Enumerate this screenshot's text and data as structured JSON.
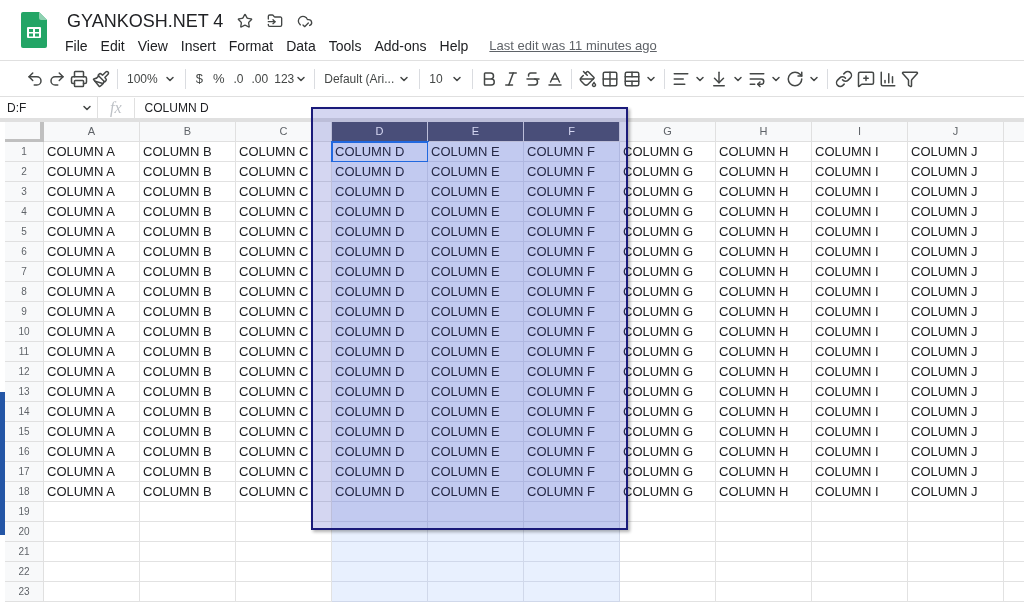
{
  "document": {
    "title": "GYANKOSH.NET 4",
    "menus": [
      "File",
      "Edit",
      "View",
      "Insert",
      "Format",
      "Data",
      "Tools",
      "Add-ons",
      "Help"
    ],
    "last_edit": "Last edit was 11 minutes ago"
  },
  "toolbar": {
    "zoom": "100%",
    "currency": "$",
    "percent": "%",
    "decrease_decimals": ".0",
    "increase_decimals": ".00",
    "number_format": "123",
    "font": "Default (Ari...",
    "font_size": "10"
  },
  "formula_bar": {
    "name_box": "D:F",
    "fx": "fx",
    "content": "COLUMN D"
  },
  "grid": {
    "columns": [
      {
        "label": "A",
        "selected": false
      },
      {
        "label": "B",
        "selected": false
      },
      {
        "label": "C",
        "selected": false
      },
      {
        "label": "D",
        "selected": true
      },
      {
        "label": "E",
        "selected": true
      },
      {
        "label": "F",
        "selected": true
      },
      {
        "label": "G",
        "selected": false
      },
      {
        "label": "H",
        "selected": false
      },
      {
        "label": "I",
        "selected": false
      },
      {
        "label": "J",
        "selected": false
      }
    ],
    "rows": [
      {
        "label": "1",
        "cells": [
          {
            "text": "COLUMN A",
            "active": false
          },
          {
            "text": "COLUMN B",
            "active": false
          },
          {
            "text": "COLUMN C",
            "active": false
          },
          {
            "text": "COLUMN D",
            "active": true
          },
          {
            "text": "COLUMN E",
            "active": false
          },
          {
            "text": "COLUMN F",
            "active": false
          },
          {
            "text": "COLUMN G",
            "active": false
          },
          {
            "text": "COLUMN H",
            "active": false
          },
          {
            "text": "COLUMN I",
            "active": false
          },
          {
            "text": "COLUMN J",
            "active": false
          }
        ]
      },
      {
        "label": "2",
        "cells": [
          {
            "text": "COLUMN A",
            "active": false
          },
          {
            "text": "COLUMN B",
            "active": false
          },
          {
            "text": "COLUMN C",
            "active": false
          },
          {
            "text": "COLUMN D",
            "active": false
          },
          {
            "text": "COLUMN E",
            "active": false
          },
          {
            "text": "COLUMN F",
            "active": false
          },
          {
            "text": "COLUMN G",
            "active": false
          },
          {
            "text": "COLUMN H",
            "active": false
          },
          {
            "text": "COLUMN I",
            "active": false
          },
          {
            "text": "COLUMN J",
            "active": false
          }
        ]
      },
      {
        "label": "3",
        "cells": [
          {
            "text": "COLUMN A",
            "active": false
          },
          {
            "text": "COLUMN B",
            "active": false
          },
          {
            "text": "COLUMN C",
            "active": false
          },
          {
            "text": "COLUMN D",
            "active": false
          },
          {
            "text": "COLUMN E",
            "active": false
          },
          {
            "text": "COLUMN F",
            "active": false
          },
          {
            "text": "COLUMN G",
            "active": false
          },
          {
            "text": "COLUMN H",
            "active": false
          },
          {
            "text": "COLUMN I",
            "active": false
          },
          {
            "text": "COLUMN J",
            "active": false
          }
        ]
      },
      {
        "label": "4",
        "cells": [
          {
            "text": "COLUMN A",
            "active": false
          },
          {
            "text": "COLUMN B",
            "active": false
          },
          {
            "text": "COLUMN C",
            "active": false
          },
          {
            "text": "COLUMN D",
            "active": false
          },
          {
            "text": "COLUMN E",
            "active": false
          },
          {
            "text": "COLUMN F",
            "active": false
          },
          {
            "text": "COLUMN G",
            "active": false
          },
          {
            "text": "COLUMN H",
            "active": false
          },
          {
            "text": "COLUMN I",
            "active": false
          },
          {
            "text": "COLUMN J",
            "active": false
          }
        ]
      },
      {
        "label": "5",
        "cells": [
          {
            "text": "COLUMN A",
            "active": false
          },
          {
            "text": "COLUMN B",
            "active": false
          },
          {
            "text": "COLUMN C",
            "active": false
          },
          {
            "text": "COLUMN D",
            "active": false
          },
          {
            "text": "COLUMN E",
            "active": false
          },
          {
            "text": "COLUMN F",
            "active": false
          },
          {
            "text": "COLUMN G",
            "active": false
          },
          {
            "text": "COLUMN H",
            "active": false
          },
          {
            "text": "COLUMN I",
            "active": false
          },
          {
            "text": "COLUMN J",
            "active": false
          }
        ]
      },
      {
        "label": "6",
        "cells": [
          {
            "text": "COLUMN A",
            "active": false
          },
          {
            "text": "COLUMN B",
            "active": false
          },
          {
            "text": "COLUMN C",
            "active": false
          },
          {
            "text": "COLUMN D",
            "active": false
          },
          {
            "text": "COLUMN E",
            "active": false
          },
          {
            "text": "COLUMN F",
            "active": false
          },
          {
            "text": "COLUMN G",
            "active": false
          },
          {
            "text": "COLUMN H",
            "active": false
          },
          {
            "text": "COLUMN I",
            "active": false
          },
          {
            "text": "COLUMN J",
            "active": false
          }
        ]
      },
      {
        "label": "7",
        "cells": [
          {
            "text": "COLUMN A",
            "active": false
          },
          {
            "text": "COLUMN B",
            "active": false
          },
          {
            "text": "COLUMN C",
            "active": false
          },
          {
            "text": "COLUMN D",
            "active": false
          },
          {
            "text": "COLUMN E",
            "active": false
          },
          {
            "text": "COLUMN F",
            "active": false
          },
          {
            "text": "COLUMN G",
            "active": false
          },
          {
            "text": "COLUMN H",
            "active": false
          },
          {
            "text": "COLUMN I",
            "active": false
          },
          {
            "text": "COLUMN J",
            "active": false
          }
        ]
      },
      {
        "label": "8",
        "cells": [
          {
            "text": "COLUMN A",
            "active": false
          },
          {
            "text": "COLUMN B",
            "active": false
          },
          {
            "text": "COLUMN C",
            "active": false
          },
          {
            "text": "COLUMN D",
            "active": false
          },
          {
            "text": "COLUMN E",
            "active": false
          },
          {
            "text": "COLUMN F",
            "active": false
          },
          {
            "text": "COLUMN G",
            "active": false
          },
          {
            "text": "COLUMN H",
            "active": false
          },
          {
            "text": "COLUMN I",
            "active": false
          },
          {
            "text": "COLUMN J",
            "active": false
          }
        ]
      },
      {
        "label": "9",
        "cells": [
          {
            "text": "COLUMN A",
            "active": false
          },
          {
            "text": "COLUMN B",
            "active": false
          },
          {
            "text": "COLUMN C",
            "active": false
          },
          {
            "text": "COLUMN D",
            "active": false
          },
          {
            "text": "COLUMN E",
            "active": false
          },
          {
            "text": "COLUMN F",
            "active": false
          },
          {
            "text": "COLUMN G",
            "active": false
          },
          {
            "text": "COLUMN H",
            "active": false
          },
          {
            "text": "COLUMN I",
            "active": false
          },
          {
            "text": "COLUMN J",
            "active": false
          }
        ]
      },
      {
        "label": "10",
        "cells": [
          {
            "text": "COLUMN A",
            "active": false
          },
          {
            "text": "COLUMN B",
            "active": false
          },
          {
            "text": "COLUMN C",
            "active": false
          },
          {
            "text": "COLUMN D",
            "active": false
          },
          {
            "text": "COLUMN E",
            "active": false
          },
          {
            "text": "COLUMN F",
            "active": false
          },
          {
            "text": "COLUMN G",
            "active": false
          },
          {
            "text": "COLUMN H",
            "active": false
          },
          {
            "text": "COLUMN I",
            "active": false
          },
          {
            "text": "COLUMN J",
            "active": false
          }
        ]
      },
      {
        "label": "11",
        "cells": [
          {
            "text": "COLUMN A",
            "active": false
          },
          {
            "text": "COLUMN B",
            "active": false
          },
          {
            "text": "COLUMN C",
            "active": false
          },
          {
            "text": "COLUMN D",
            "active": false
          },
          {
            "text": "COLUMN E",
            "active": false
          },
          {
            "text": "COLUMN F",
            "active": false
          },
          {
            "text": "COLUMN G",
            "active": false
          },
          {
            "text": "COLUMN H",
            "active": false
          },
          {
            "text": "COLUMN I",
            "active": false
          },
          {
            "text": "COLUMN J",
            "active": false
          }
        ]
      },
      {
        "label": "12",
        "cells": [
          {
            "text": "COLUMN A",
            "active": false
          },
          {
            "text": "COLUMN B",
            "active": false
          },
          {
            "text": "COLUMN C",
            "active": false
          },
          {
            "text": "COLUMN D",
            "active": false
          },
          {
            "text": "COLUMN E",
            "active": false
          },
          {
            "text": "COLUMN F",
            "active": false
          },
          {
            "text": "COLUMN G",
            "active": false
          },
          {
            "text": "COLUMN H",
            "active": false
          },
          {
            "text": "COLUMN I",
            "active": false
          },
          {
            "text": "COLUMN J",
            "active": false
          }
        ]
      },
      {
        "label": "13",
        "cells": [
          {
            "text": "COLUMN A",
            "active": false
          },
          {
            "text": "COLUMN B",
            "active": false
          },
          {
            "text": "COLUMN C",
            "active": false
          },
          {
            "text": "COLUMN D",
            "active": false
          },
          {
            "text": "COLUMN E",
            "active": false
          },
          {
            "text": "COLUMN F",
            "active": false
          },
          {
            "text": "COLUMN G",
            "active": false
          },
          {
            "text": "COLUMN H",
            "active": false
          },
          {
            "text": "COLUMN I",
            "active": false
          },
          {
            "text": "COLUMN J",
            "active": false
          }
        ]
      },
      {
        "label": "14",
        "cells": [
          {
            "text": "COLUMN A",
            "active": false
          },
          {
            "text": "COLUMN B",
            "active": false
          },
          {
            "text": "COLUMN C",
            "active": false
          },
          {
            "text": "COLUMN D",
            "active": false
          },
          {
            "text": "COLUMN E",
            "active": false
          },
          {
            "text": "COLUMN F",
            "active": false
          },
          {
            "text": "COLUMN G",
            "active": false
          },
          {
            "text": "COLUMN H",
            "active": false
          },
          {
            "text": "COLUMN I",
            "active": false
          },
          {
            "text": "COLUMN J",
            "active": false
          }
        ]
      },
      {
        "label": "15",
        "cells": [
          {
            "text": "COLUMN A",
            "active": false
          },
          {
            "text": "COLUMN B",
            "active": false
          },
          {
            "text": "COLUMN C",
            "active": false
          },
          {
            "text": "COLUMN D",
            "active": false
          },
          {
            "text": "COLUMN E",
            "active": false
          },
          {
            "text": "COLUMN F",
            "active": false
          },
          {
            "text": "COLUMN G",
            "active": false
          },
          {
            "text": "COLUMN H",
            "active": false
          },
          {
            "text": "COLUMN I",
            "active": false
          },
          {
            "text": "COLUMN J",
            "active": false
          }
        ]
      },
      {
        "label": "16",
        "cells": [
          {
            "text": "COLUMN A",
            "active": false
          },
          {
            "text": "COLUMN B",
            "active": false
          },
          {
            "text": "COLUMN C",
            "active": false
          },
          {
            "text": "COLUMN D",
            "active": false
          },
          {
            "text": "COLUMN E",
            "active": false
          },
          {
            "text": "COLUMN F",
            "active": false
          },
          {
            "text": "COLUMN G",
            "active": false
          },
          {
            "text": "COLUMN H",
            "active": false
          },
          {
            "text": "COLUMN I",
            "active": false
          },
          {
            "text": "COLUMN J",
            "active": false
          }
        ]
      },
      {
        "label": "17",
        "cells": [
          {
            "text": "COLUMN A",
            "active": false
          },
          {
            "text": "COLUMN B",
            "active": false
          },
          {
            "text": "COLUMN C",
            "active": false
          },
          {
            "text": "COLUMN D",
            "active": false
          },
          {
            "text": "COLUMN E",
            "active": false
          },
          {
            "text": "COLUMN F",
            "active": false
          },
          {
            "text": "COLUMN G",
            "active": false
          },
          {
            "text": "COLUMN H",
            "active": false
          },
          {
            "text": "COLUMN I",
            "active": false
          },
          {
            "text": "COLUMN J",
            "active": false
          }
        ]
      },
      {
        "label": "18",
        "cells": [
          {
            "text": "COLUMN A",
            "active": false
          },
          {
            "text": "COLUMN B",
            "active": false
          },
          {
            "text": "COLUMN C",
            "active": false
          },
          {
            "text": "COLUMN D",
            "active": false
          },
          {
            "text": "COLUMN E",
            "active": false
          },
          {
            "text": "COLUMN F",
            "active": false
          },
          {
            "text": "COLUMN G",
            "active": false
          },
          {
            "text": "COLUMN H",
            "active": false
          },
          {
            "text": "COLUMN I",
            "active": false
          },
          {
            "text": "COLUMN J",
            "active": false
          }
        ]
      },
      {
        "label": "19"
      },
      {
        "label": "20"
      },
      {
        "label": "21"
      },
      {
        "label": "22"
      },
      {
        "label": "23"
      }
    ]
  }
}
